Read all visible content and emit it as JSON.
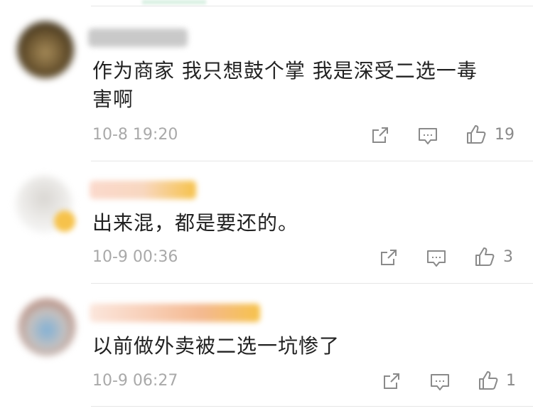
{
  "comments": [
    {
      "text_line1": "作为商家   我只想鼓个掌 我是深受二选一毒",
      "text_line2": "害啊",
      "time": "10-8 19:20",
      "likes": "19"
    },
    {
      "text_line1": "出来混，都是要还的。",
      "time": "10-9 00:36",
      "likes": "3"
    },
    {
      "text_line1": "以前做外卖被二选一坑惨了",
      "time": "10-9 06:27",
      "likes": "1"
    }
  ],
  "icons": {
    "share": "share-icon",
    "reply": "comment-reply-icon",
    "like": "thumbs-up-icon"
  },
  "colors": {
    "text": "#222222",
    "meta": "#a9a9a9",
    "icon": "#8a8a8a",
    "divider": "#e6e6e6",
    "vip_badge": "#f6c24b"
  }
}
